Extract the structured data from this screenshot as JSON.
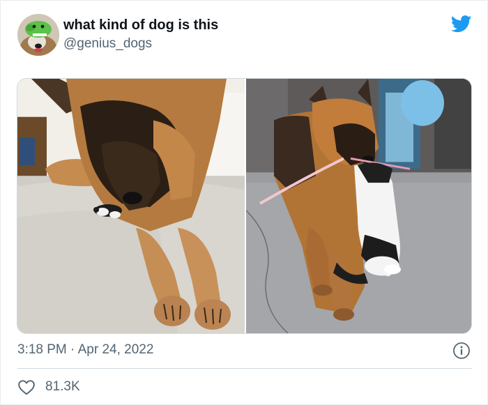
{
  "tweet": {
    "display_name": "what kind of dog is this",
    "handle": "@genius_dogs",
    "time": "3:18 PM",
    "separator": "·",
    "date": "Apr 24, 2022",
    "like_count": "81.3K"
  },
  "icons": {
    "brand": "twitter-bird-icon",
    "info": "info-icon",
    "like": "heart-icon"
  },
  "colors": {
    "twitter_blue": "#1d9bf0",
    "secondary_text": "#536471",
    "primary_text": "#0f1419",
    "border": "#cfd9de"
  }
}
